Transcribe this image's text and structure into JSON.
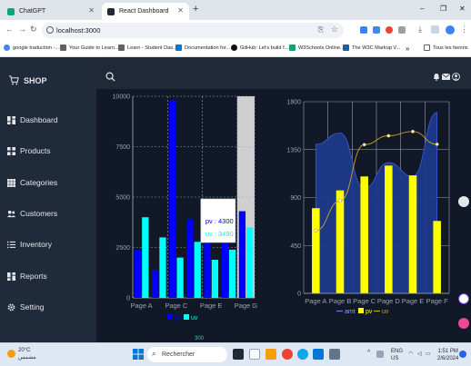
{
  "browser": {
    "tabs": [
      {
        "title": "ChatGPT",
        "active": false
      },
      {
        "title": "React Dashboard",
        "active": true
      }
    ],
    "new_tab": "+",
    "window_controls": {
      "minimize": "–",
      "restore": "❐",
      "close": "✕"
    },
    "address": "localhost:3000",
    "bookmarks": [
      {
        "label": "google traduction -...",
        "color": "#4285f4"
      },
      {
        "label": "Your Guide to Learn...",
        "color": "#5f6368"
      },
      {
        "label": "Learn - Student Das...",
        "color": "#5f6368"
      },
      {
        "label": "Documentation for...",
        "color": "#0078d4"
      },
      {
        "label": "GitHub: Let's build f...",
        "color": "#111111"
      },
      {
        "label": "W3Schools Online...",
        "color": "#04aa6d"
      },
      {
        "label": "The W3C Markup V...",
        "color": "#1a5ea8"
      }
    ],
    "more_bookmarks": "»",
    "all_favorites": "Tous les favoris"
  },
  "app": {
    "brand": "SHOP",
    "nav": [
      {
        "label": "Dashboard",
        "icon": "dashboard-icon"
      },
      {
        "label": "Products",
        "icon": "products-icon"
      },
      {
        "label": "Categories",
        "icon": "categories-icon"
      },
      {
        "label": "Customers",
        "icon": "customers-icon"
      },
      {
        "label": "Inventory",
        "icon": "inventory-icon"
      },
      {
        "label": "Reports",
        "icon": "reports-icon"
      },
      {
        "label": "Setting",
        "icon": "setting-icon"
      }
    ],
    "bottom_partial_label": "300",
    "colors": {
      "sidebar": "#1f2a3a",
      "topbar": "#1f2937",
      "main": "#111827",
      "pv": "#0000ff",
      "uv": "#00ffff",
      "amt": "#1e3a8a",
      "pv2": "#ffff00",
      "uv2": "#c9a227"
    }
  },
  "chart_data": [
    {
      "type": "bar",
      "categories": [
        "Page A",
        "Page B",
        "Page C",
        "Page D",
        "Page E",
        "Page F",
        "Page G"
      ],
      "visible_tick_labels": [
        "Page A",
        "Page C",
        "Page E",
        "Page G"
      ],
      "series": [
        {
          "name": "pv",
          "values": [
            2400,
            1398,
            9800,
            3908,
            4800,
            3800,
            4300
          ]
        },
        {
          "name": "uv",
          "values": [
            4000,
            3000,
            2000,
            2780,
            1890,
            2390,
            3490
          ]
        }
      ],
      "yticks": [
        0,
        2500,
        5000,
        7500,
        10000
      ],
      "ylim": [
        0,
        10000
      ],
      "grid": true,
      "legend": "bottom",
      "tooltip": {
        "category_index": 6,
        "pv_label": "pv : 4300",
        "uv_label": "uv : 3490"
      }
    },
    {
      "type": "composed",
      "categories": [
        "Page A",
        "Page B",
        "Page C",
        "Page D",
        "Page E",
        "Page F"
      ],
      "series": [
        {
          "name": "amt",
          "kind": "area",
          "values": [
            1400,
            1506,
            989,
            1228,
            1100,
            1700
          ]
        },
        {
          "name": "pv",
          "kind": "bar",
          "values": [
            800,
            967,
            1098,
            1200,
            1108,
            680
          ]
        },
        {
          "name": "uv",
          "kind": "line",
          "values": [
            590,
            868,
            1397,
            1480,
            1520,
            1400
          ]
        }
      ],
      "yticks": [
        0,
        450,
        900,
        1350,
        1800
      ],
      "ylim": [
        0,
        1800
      ],
      "grid": true,
      "legend": "bottom"
    }
  ],
  "taskbar": {
    "weather_temp": "20°C",
    "weather_desc": "مشمس",
    "search_placeholder": "Rechercher",
    "lang_top": "ENG",
    "lang_bottom": "US",
    "time": "1:51 PM",
    "date": "2/6/2024"
  }
}
